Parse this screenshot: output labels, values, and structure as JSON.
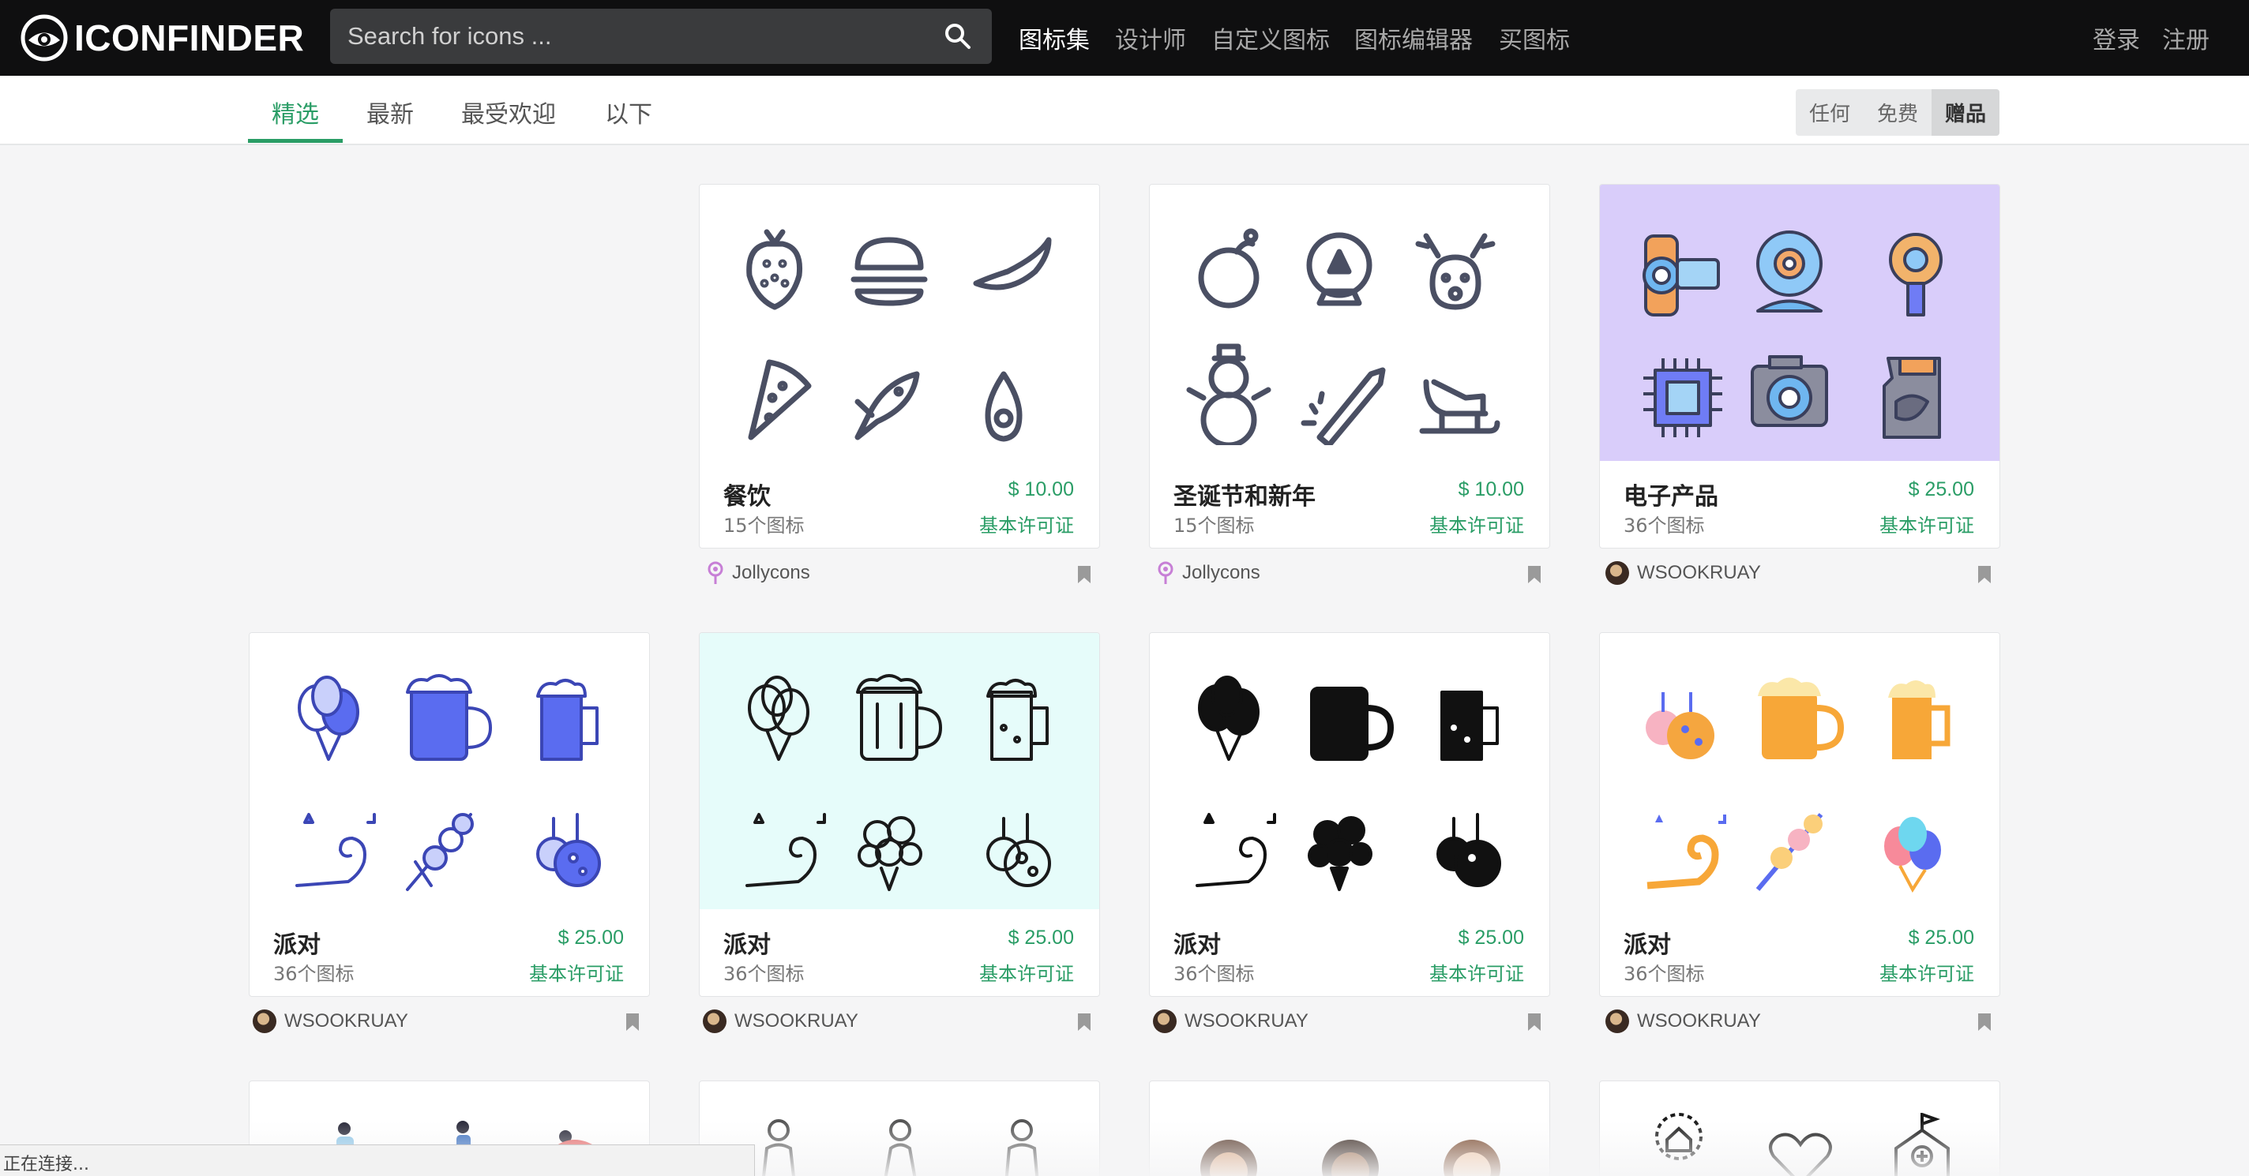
{
  "brand": {
    "name": "ICONFINDER"
  },
  "search": {
    "placeholder": "Search for icons ..."
  },
  "nav": {
    "links": [
      "图标集",
      "设计师",
      "自定义图标",
      "图标编辑器",
      "买图标"
    ],
    "login": "登录",
    "register": "注册"
  },
  "subnav": {
    "tabs": [
      "精选",
      "最新",
      "最受欢迎",
      "以下"
    ],
    "filter": [
      "任何",
      "免费",
      "赠品"
    ]
  },
  "cards": [
    {
      "title": "餐饮",
      "count": "15个图标",
      "price": "$ 10.00",
      "license": "基本许可证",
      "author": "Jollycons",
      "style": "outline",
      "icons": [
        "strawberry-icon",
        "burger-icon",
        "banana-icon",
        "pizza-icon",
        "fish-icon",
        "avocado-icon"
      ]
    },
    {
      "title": "圣诞节和新年",
      "count": "15个图标",
      "price": "$ 10.00",
      "license": "基本许可证",
      "author": "Jollycons",
      "style": "outline",
      "icons": [
        "ornament-icon",
        "snow-globe-icon",
        "reindeer-icon",
        "snowman-icon",
        "rocket-firework-icon",
        "sleigh-icon"
      ]
    },
    {
      "title": "电子产品",
      "count": "36个图标",
      "price": "$ 25.00",
      "license": "基本许可证",
      "author": "WSOOKRUAY",
      "style": "colorful",
      "icons": [
        "camcorder-icon",
        "webcam-icon",
        "usb-plug-icon",
        "cpu-chip-icon",
        "camera-icon",
        "sd-card-icon"
      ]
    },
    {
      "title": "派对",
      "count": "36个图标",
      "price": "$ 25.00",
      "license": "基本许可证",
      "author": "WSOOKRUAY",
      "style": "blue",
      "icons": [
        "balloons-icon",
        "beer-mug-icon",
        "beer-glass-icon",
        "party-horn-icon",
        "skewer-icon",
        "disco-ball-icon"
      ]
    },
    {
      "title": "派对",
      "count": "36个图标",
      "price": "$ 25.00",
      "license": "基本许可证",
      "author": "WSOOKRUAY",
      "style": "outline-black",
      "icons": [
        "balloons-icon",
        "beer-mug-icon",
        "beer-glass-icon",
        "party-horn-icon",
        "bouquet-icon",
        "disco-ball-icon"
      ]
    },
    {
      "title": "派对",
      "count": "36个图标",
      "price": "$ 25.00",
      "license": "基本许可证",
      "author": "WSOOKRUAY",
      "style": "glyph",
      "icons": [
        "balloons-icon",
        "beer-mug-icon",
        "beer-glass-icon",
        "party-horn-icon",
        "bouquet-icon",
        "disco-ball-icon"
      ]
    },
    {
      "title": "派对",
      "count": "36个图标",
      "price": "$ 25.00",
      "license": "基本许可证",
      "author": "WSOOKRUAY",
      "style": "flat",
      "icons": [
        "disco-ball-icon",
        "beer-mug-icon",
        "beer-glass-icon",
        "party-horn-icon",
        "skewer-icon",
        "balloons-icon"
      ]
    }
  ],
  "status": "正在连接..."
}
